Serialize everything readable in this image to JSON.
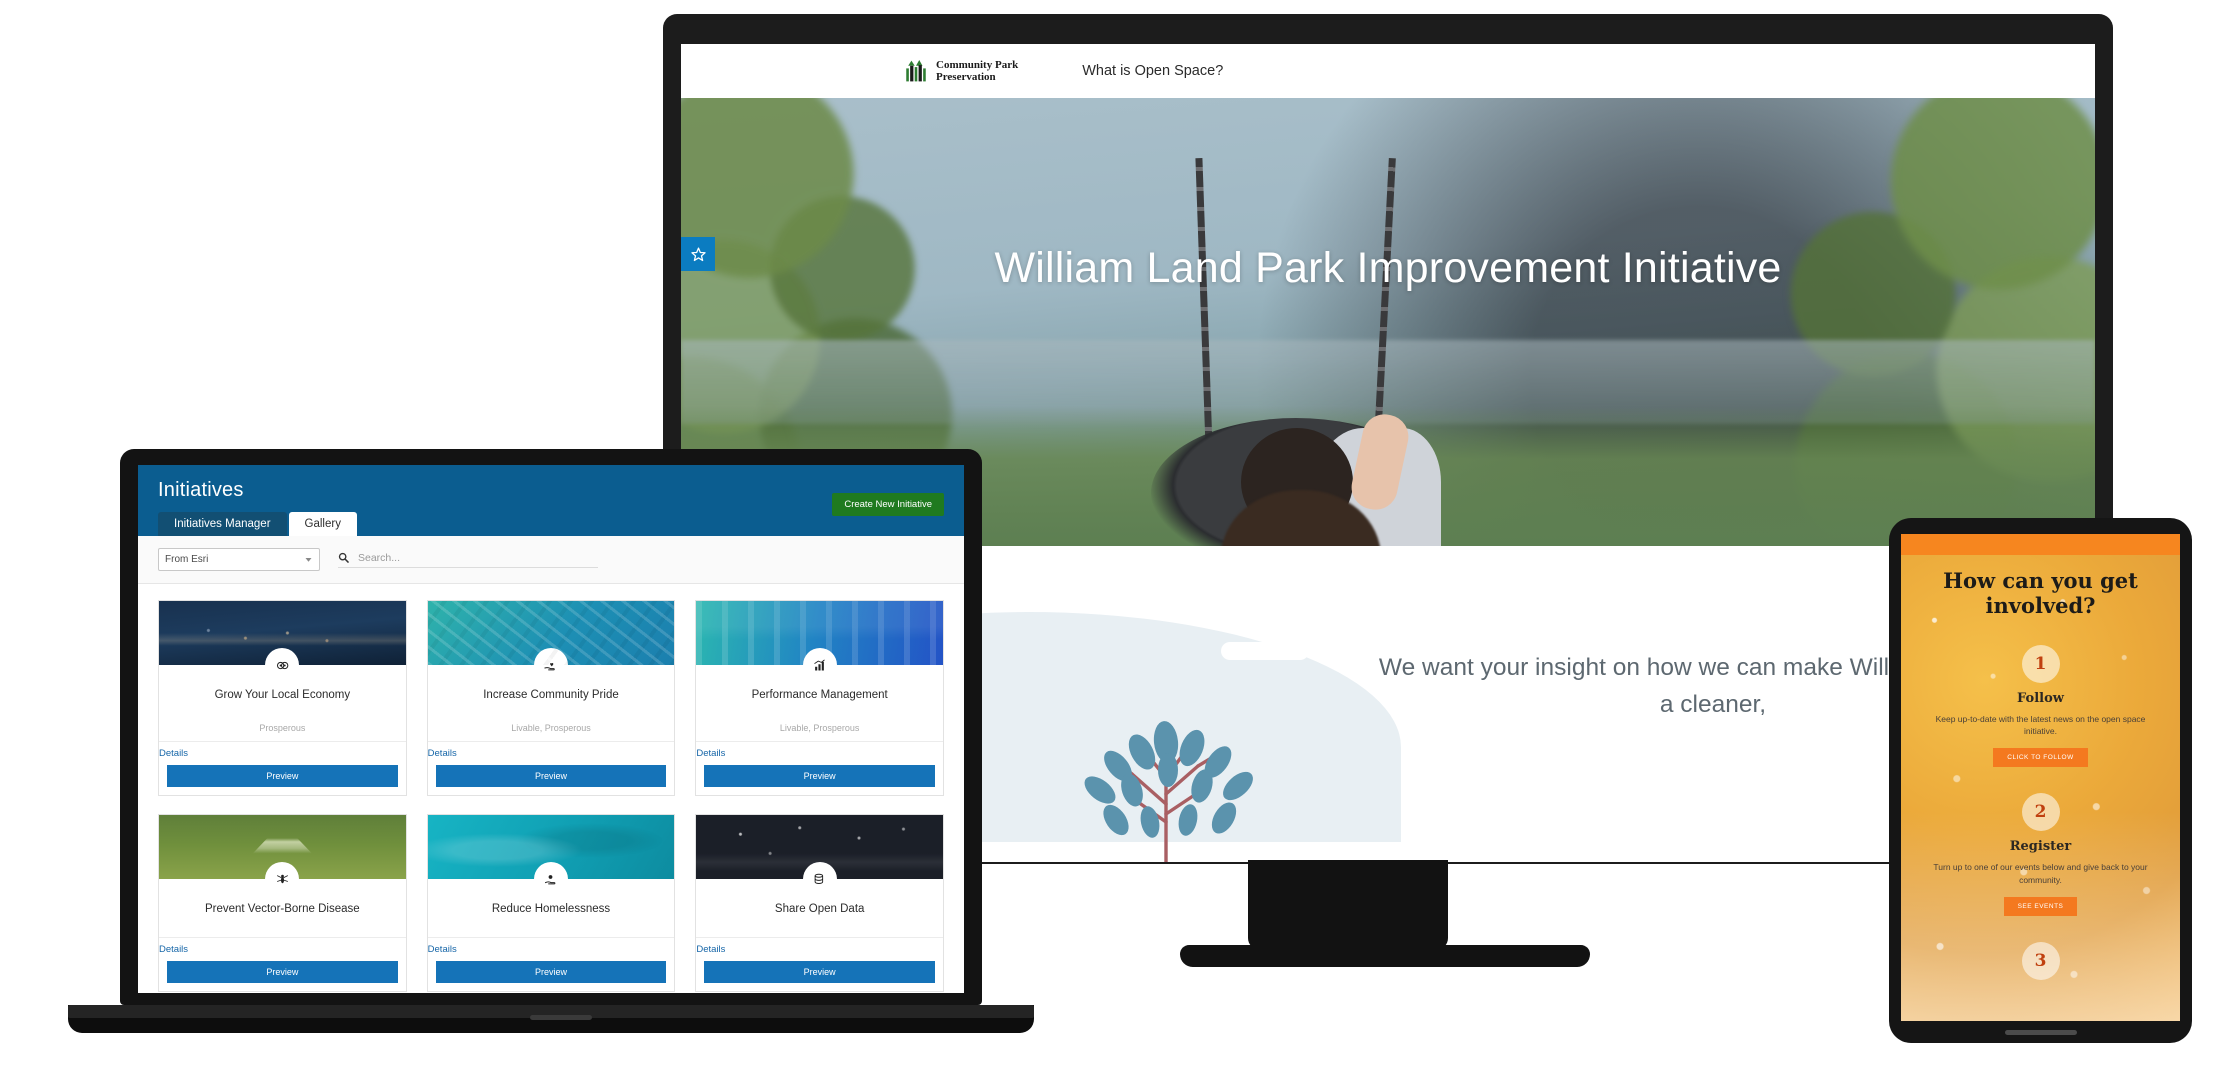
{
  "desktop": {
    "header": {
      "brand_line1": "Community Park",
      "brand_line2": "Preservation",
      "logo_icon": "three-trees-logo-icon",
      "nav": [
        {
          "label": "What is Open Space?"
        }
      ]
    },
    "hero": {
      "title": "William Land Park Improvement Initiative",
      "follow_badge_icon": "star-icon"
    },
    "body": {
      "subtitle": "We want your insight on how we can make William Land Park a cleaner,",
      "illustration": "tree-illustration"
    }
  },
  "laptop": {
    "app": {
      "title": "Initiatives",
      "tabs": [
        {
          "label": "Initiatives Manager",
          "active": false
        },
        {
          "label": "Gallery",
          "active": true
        }
      ],
      "create_button": "Create New Initiative",
      "toolbar": {
        "filter_value": "From Esri",
        "filter_caret_icon": "chevron-down-icon",
        "search_icon": "search-icon",
        "search_placeholder": "Search..."
      },
      "card_labels": {
        "details": "Details",
        "preview": "Preview"
      },
      "cards": [
        {
          "name": "Grow Your Local Economy",
          "tags": "Prosperous",
          "icon": "money-icon",
          "thumb": "th-city"
        },
        {
          "name": "Increase Community Pride",
          "tags": "Livable, Prosperous",
          "icon": "hand-heart-icon",
          "thumb": "th-aerial"
        },
        {
          "name": "Performance Management",
          "tags": "Livable, Prosperous",
          "icon": "bar-chart-icon",
          "thumb": "th-street"
        },
        {
          "name": "Prevent Vector-Borne Disease",
          "tags": "",
          "icon": "mosquito-icon",
          "thumb": "th-field"
        },
        {
          "name": "Reduce Homelessness",
          "tags": "",
          "icon": "hand-person-icon",
          "thumb": "th-teal"
        },
        {
          "name": "Share Open Data",
          "tags": "",
          "icon": "database-icon",
          "thumb": "th-dark"
        }
      ]
    }
  },
  "mobile": {
    "title": "How can you get involved?",
    "steps": [
      {
        "number": "1",
        "title": "Follow",
        "desc": "Keep up-to-date with the latest news on the open space initiative.",
        "button": "CLICK TO FOLLOW"
      },
      {
        "number": "2",
        "title": "Register",
        "desc": "Turn up to one of our events below and give back to your community.",
        "button": "SEE EVENTS"
      },
      {
        "number": "3",
        "title": "",
        "desc": "",
        "button": ""
      }
    ]
  },
  "colors": {
    "app_header_blue": "#0b5d90",
    "app_button_blue": "#1573b8",
    "create_green": "#1f7a1f",
    "mobile_orange": "#f4791f",
    "badge_blue": "#0b7cc1",
    "brand_green": "#2e7d32"
  }
}
